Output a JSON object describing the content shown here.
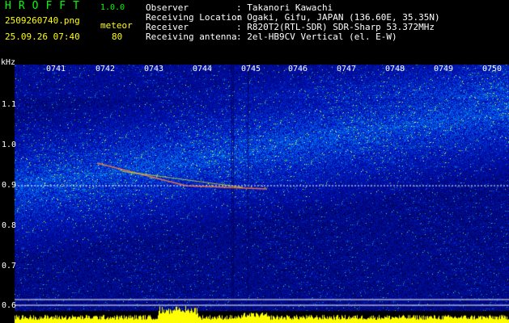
{
  "app": {
    "logo": "HROFFT",
    "version": "1.0.0",
    "filename": "2509260740.png",
    "datetime": "25.09.26 07:40",
    "mode_label": "meteor",
    "count": "80"
  },
  "info": {
    "rows": [
      {
        "label": "Observer",
        "value": ": Takanori Kawachi"
      },
      {
        "label": "Receiving Location",
        "value": ": Ogaki, Gifu, JAPAN (136.60E, 35.35N)"
      },
      {
        "label": "Receiver",
        "value": ": R820T2(RTL-SDR) SDR-Sharp 53.372MHz"
      },
      {
        "label": "Receiving antenna",
        "value": ": 2el-HB9CV Vertical (el. E-W)"
      }
    ]
  },
  "axes": {
    "unit": "kHz",
    "time_ticks": [
      "0741",
      "0742",
      "0743",
      "0744",
      "0745",
      "0746",
      "0747",
      "0748",
      "0749",
      "0750"
    ],
    "freq_ticks": [
      "1.1",
      "1.0",
      "0.9",
      "0.8",
      "0.7",
      "0.6"
    ]
  },
  "colors": {
    "background": "#000000",
    "spectrogram_low": "#00006e",
    "spectrogram_high": "#ffffff",
    "reference_line": "#ffffff",
    "level_bar": "#ffff00",
    "header_green": "#00ff00",
    "header_yellow": "#ffff00"
  }
}
